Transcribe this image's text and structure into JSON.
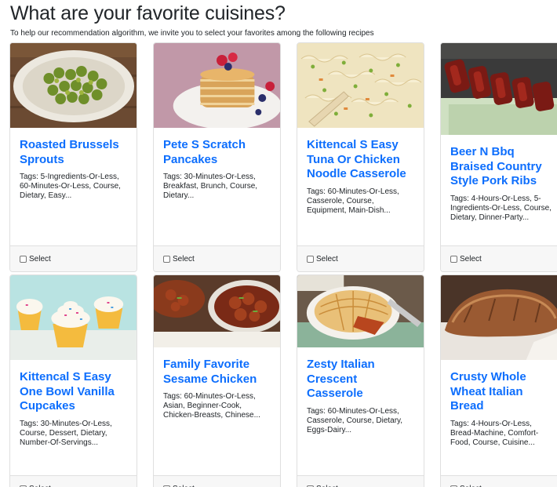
{
  "header": {
    "title": "What are your favorite cuisines?",
    "subtitle": "To help our recommendation algorithm, we invite you to select your favorites among the following recipes"
  },
  "select_label": "Select",
  "recipes": [
    {
      "title": "Roasted Brussels Sprouts",
      "tags": "Tags: 5-Ingredients-Or-Less, 60-Minutes-Or-Less, Course, Dietary, Easy..."
    },
    {
      "title": "Pete S Scratch Pancakes",
      "tags": "Tags: 30-Minutes-Or-Less, Breakfast, Brunch, Course, Dietary..."
    },
    {
      "title": "Kittencal S Easy Tuna Or Chicken Noodle Casserole",
      "tags": "Tags: 60-Minutes-Or-Less, Casserole, Course, Equipment, Main-Dish..."
    },
    {
      "title": "Beer N Bbq Braised Country Style Pork Ribs",
      "tags": "Tags: 4-Hours-Or-Less, 5-Ingredients-Or-Less, Course, Dietary, Dinner-Party..."
    },
    {
      "title": "Kittencal S Easy One Bowl Vanilla Cupcakes",
      "tags": "Tags: 30-Minutes-Or-Less, Course, Dessert, Dietary, Number-Of-Servings..."
    },
    {
      "title": "Family Favorite Sesame Chicken",
      "tags": "Tags: 60-Minutes-Or-Less, Asian, Beginner-Cook, Chicken-Breasts, Chinese..."
    },
    {
      "title": "Zesty Italian Crescent Casserole",
      "tags": "Tags: 60-Minutes-Or-Less, Casserole, Course, Dietary, Eggs-Dairy..."
    },
    {
      "title": "Crusty Whole Wheat Italian Bread",
      "tags": "Tags: 4-Hours-Or-Less, Bread-Machine, Comfort-Food, Course, Cuisine..."
    }
  ]
}
